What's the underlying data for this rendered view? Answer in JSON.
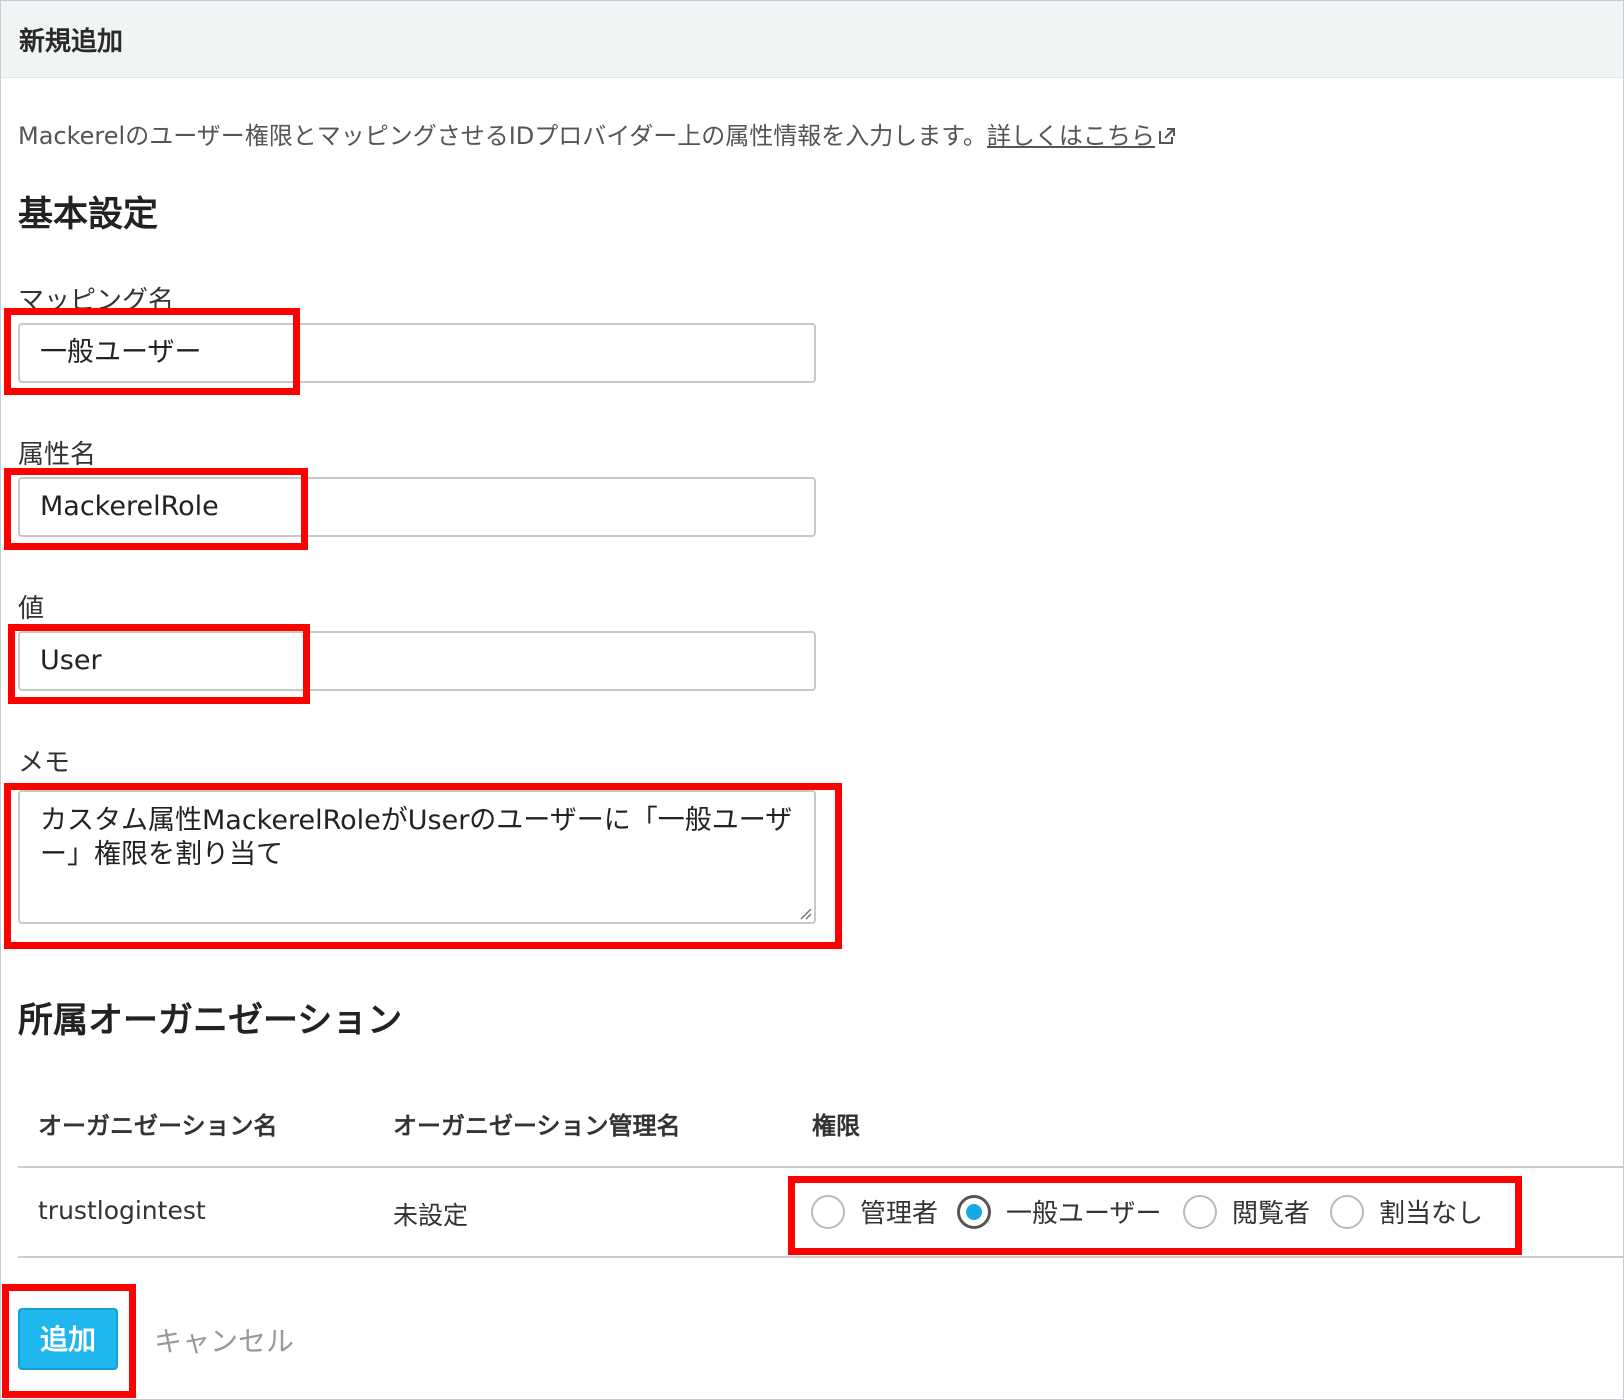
{
  "header": {
    "title": "新規追加"
  },
  "description": {
    "text": "Mackerelのユーザー権限とマッピングさせるIDプロバイダー上の属性情報を入力します。",
    "link": "詳しくはこちら"
  },
  "basic": {
    "heading": "基本設定",
    "mapping_name": {
      "label": "マッピング名",
      "value": "一般ユーザー"
    },
    "attribute_name": {
      "label": "属性名",
      "value": "MackerelRole"
    },
    "value": {
      "label": "値",
      "value": "User"
    },
    "memo": {
      "label": "メモ",
      "value": "カスタム属性MackerelRoleがUserのユーザーに「一般ユーザー」権限を割り当て"
    }
  },
  "org": {
    "heading": "所属オーガニゼーション",
    "columns": [
      "オーガニゼーション名",
      "オーガニゼーション管理名",
      "権限"
    ],
    "rows": [
      {
        "name": "trustlogintest",
        "managed_name": "未設定"
      }
    ],
    "roles": [
      "管理者",
      "一般ユーザー",
      "閲覧者",
      "割当なし"
    ],
    "selected_role": "一般ユーザー"
  },
  "actions": {
    "add": "追加",
    "cancel": "キャンセル"
  },
  "colors": {
    "highlight": "#ff0000",
    "primary": "#20b6ee",
    "radio_selected": "#1aa8e4"
  }
}
